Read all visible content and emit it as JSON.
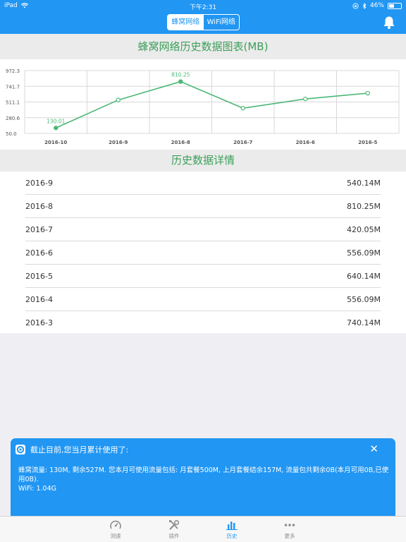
{
  "status_bar": {
    "device": "iPad",
    "time": "下午2:31",
    "battery": "46%",
    "battery_level": 0.46
  },
  "segment": {
    "items": [
      {
        "label": "蜂窝网络",
        "active": true
      },
      {
        "label": "WiFi网络",
        "active": false
      }
    ]
  },
  "chart_title": "蜂窝网络历史数据图表(MB)",
  "detail_title": "历史数据详情",
  "chart_data": {
    "type": "line",
    "categories": [
      "2016-10",
      "2016-9",
      "2016-8",
      "2016-7",
      "2016-6",
      "2016-5"
    ],
    "series": [
      {
        "values": [
          130.01,
          540.14,
          810.25,
          420.05,
          556.09,
          640.14
        ]
      }
    ],
    "y_ticks": [
      "972.3",
      "741.7",
      "511.1",
      "280.6",
      "50.0"
    ],
    "ylim": [
      50.0,
      972.3
    ],
    "data_labels": [
      {
        "index": 0,
        "text": "130.01"
      },
      {
        "index": 2,
        "text": "810.25"
      }
    ],
    "grid": true,
    "line_color": "#4cb877"
  },
  "history": [
    {
      "month": "2016-9",
      "value": "540.14M"
    },
    {
      "month": "2016-8",
      "value": "810.25M"
    },
    {
      "month": "2016-7",
      "value": "420.05M"
    },
    {
      "month": "2016-6",
      "value": "556.09M"
    },
    {
      "month": "2016-5",
      "value": "640.14M"
    },
    {
      "month": "2016-4",
      "value": "556.09M"
    },
    {
      "month": "2016-3",
      "value": "740.14M"
    }
  ],
  "notice": {
    "title": "截止目前,您当月累计使用了:",
    "close": "✕",
    "line1": "蜂窝流量: 130M, 剩余527M. 您本月可使用流量包括: 月套餐500M, 上月套餐结余157M, 流量包共剩余0B(本月可用0B,已使用0B).",
    "line2": "WiFi: 1.04G"
  },
  "tabs": [
    {
      "label": "测速",
      "icon": "speedometer-icon",
      "active": false
    },
    {
      "label": "插件",
      "icon": "tools-icon",
      "active": false
    },
    {
      "label": "历史",
      "icon": "bar-chart-icon",
      "active": true
    },
    {
      "label": "更多",
      "icon": "more-dots-icon",
      "active": false
    }
  ],
  "colors": {
    "primary": "#2196f3",
    "green": "#3c9f5a"
  }
}
